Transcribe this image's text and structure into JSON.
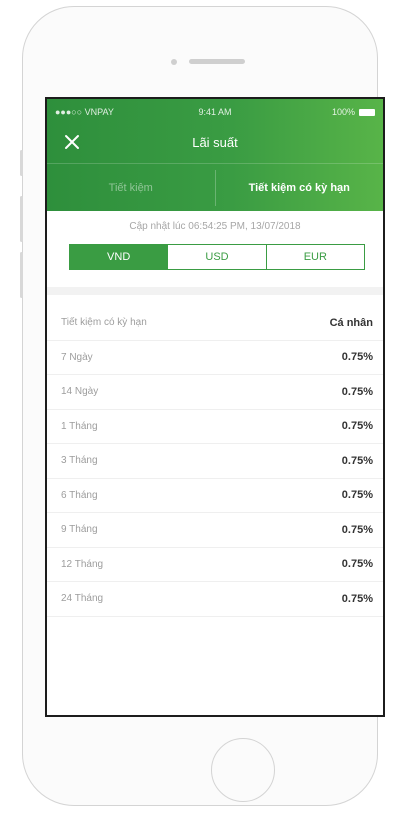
{
  "status_bar": {
    "carrier": "●●●○○ VNPAY",
    "time": "9:41 AM",
    "battery": "100%"
  },
  "nav": {
    "title": "Lãi suất",
    "close_icon": "close-icon"
  },
  "tabs": [
    {
      "label": "Tiết kiệm",
      "active": false
    },
    {
      "label": "Tiết kiệm có kỳ hạn",
      "active": true
    }
  ],
  "updated_text": "Cập nhật lúc 06:54:25 PM, 13/07/2018",
  "currencies": [
    {
      "label": "VND",
      "active": true
    },
    {
      "label": "USD",
      "active": false
    },
    {
      "label": "EUR",
      "active": false
    }
  ],
  "table": {
    "headers": {
      "term": "Tiết kiệm có kỳ hạn",
      "rate": "Cá nhân"
    },
    "rows": [
      {
        "term": "7 Ngày",
        "rate": "0.75%"
      },
      {
        "term": "14 Ngày",
        "rate": "0.75%"
      },
      {
        "term": "1 Tháng",
        "rate": "0.75%"
      },
      {
        "term": "3 Tháng",
        "rate": "0.75%"
      },
      {
        "term": "6 Tháng",
        "rate": "0.75%"
      },
      {
        "term": "9 Tháng",
        "rate": "0.75%"
      },
      {
        "term": "12 Tháng",
        "rate": "0.75%"
      },
      {
        "term": "24 Tháng",
        "rate": "0.75%"
      }
    ]
  },
  "colors": {
    "brand_green": "#3a9c43",
    "header_gradient_end": "#58b448"
  }
}
